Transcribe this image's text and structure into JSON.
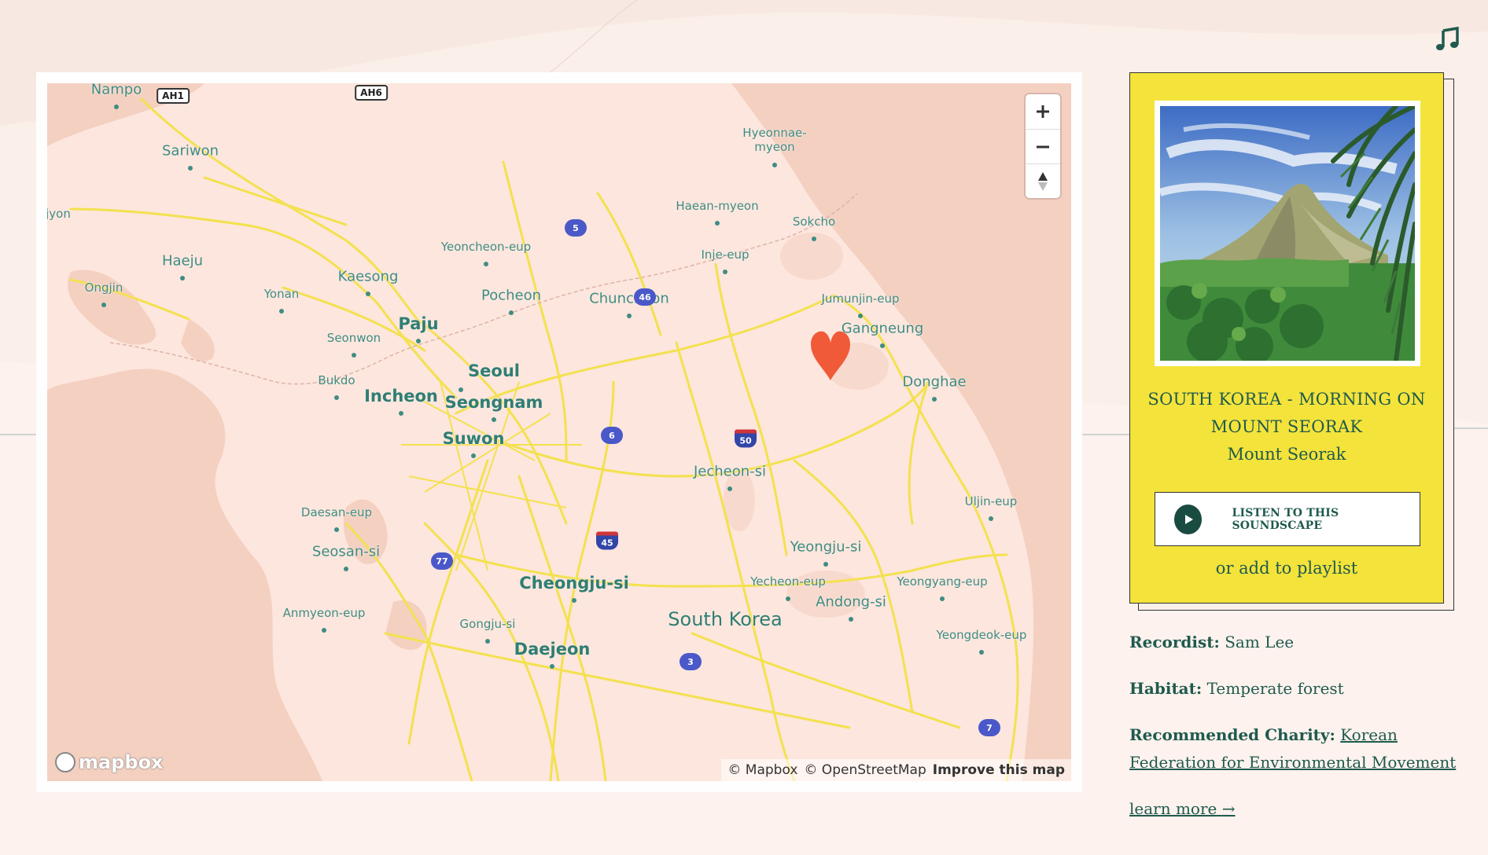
{
  "page": {
    "music_icon": "music-note-icon"
  },
  "map": {
    "zoom_in_icon": "plus-icon",
    "zoom_out_icon": "minus-icon",
    "compass_icon": "compass-icon",
    "logo_text": "mapbox",
    "attribution": {
      "mapbox": "© Mapbox",
      "osm": "© OpenStreetMap",
      "improve": "Improve this map"
    },
    "marker_icon": "heart-marker-icon",
    "marker_color": "#f05a38",
    "labels": [
      {
        "text": "Nampo",
        "cls": "mid"
      },
      {
        "text": "Sariwon",
        "cls": "mid"
      },
      {
        "text": "Haeju",
        "cls": "mid"
      },
      {
        "text": "Ongjin",
        "cls": ""
      },
      {
        "text": "Yonan",
        "cls": ""
      },
      {
        "text": "Kaesong",
        "cls": "mid"
      },
      {
        "text": "Yeoncheon-eup",
        "cls": ""
      },
      {
        "text": "Pocheon",
        "cls": "mid"
      },
      {
        "text": "Chuncheon",
        "cls": "mid"
      },
      {
        "text": "Hyeonnae-\nmyeon",
        "cls": ""
      },
      {
        "text": "Haean-myeon",
        "cls": ""
      },
      {
        "text": "Inje-eup",
        "cls": ""
      },
      {
        "text": "Sokcho",
        "cls": ""
      },
      {
        "text": "Jumunjin-eup",
        "cls": ""
      },
      {
        "text": "Gangneung",
        "cls": "mid"
      },
      {
        "text": "Donghae",
        "cls": "mid"
      },
      {
        "text": "Seonwon",
        "cls": ""
      },
      {
        "text": "Paju",
        "cls": "big"
      },
      {
        "text": "Seoul",
        "cls": "big"
      },
      {
        "text": "Bukdo",
        "cls": ""
      },
      {
        "text": "Incheon",
        "cls": "big"
      },
      {
        "text": "Seongnam",
        "cls": "big"
      },
      {
        "text": "Suwon",
        "cls": "big"
      },
      {
        "text": "Jecheon-si",
        "cls": "mid"
      },
      {
        "text": "Uljin-eup",
        "cls": ""
      },
      {
        "text": "Daesan-eup",
        "cls": ""
      },
      {
        "text": "Seosan-si",
        "cls": "mid"
      },
      {
        "text": "Yeongju-si",
        "cls": "mid"
      },
      {
        "text": "Cheongju-si",
        "cls": "big"
      },
      {
        "text": "Yecheon-eup",
        "cls": ""
      },
      {
        "text": "Yeongyang-eup",
        "cls": ""
      },
      {
        "text": "Andong-si",
        "cls": "mid"
      },
      {
        "text": "South Korea",
        "cls": "country"
      },
      {
        "text": "Anmyeon-eup",
        "cls": ""
      },
      {
        "text": "Gongju-si",
        "cls": ""
      },
      {
        "text": "Daejeon",
        "cls": "big"
      },
      {
        "text": "Yeongdeok-eup",
        "cls": ""
      },
      {
        "text": "jyon",
        "cls": ""
      }
    ],
    "shields": [
      {
        "text": "5",
        "type": "national"
      },
      {
        "text": "46",
        "type": "national"
      },
      {
        "text": "6",
        "type": "national"
      },
      {
        "text": "50",
        "type": "interstate"
      },
      {
        "text": "45",
        "type": "interstate"
      },
      {
        "text": "77",
        "type": "national"
      },
      {
        "text": "3",
        "type": "national"
      },
      {
        "text": "7",
        "type": "national"
      },
      {
        "text": "AH1",
        "type": "ah"
      },
      {
        "text": "AH6",
        "type": "ah"
      }
    ]
  },
  "card": {
    "title": "SOUTH KOREA - MORNING ON MOUNT SEORAK",
    "place": "Mount Seorak",
    "listen_label": "LISTEN TO THIS SOUNDSCAPE",
    "play_icon": "play-icon",
    "playlist_label": "or add to playlist"
  },
  "info": {
    "recordist_label": "Recordist:",
    "recordist_value": "Sam Lee",
    "habitat_label": "Habitat:",
    "habitat_value": "Temperate forest",
    "charity_label": "Recommended Charity:",
    "charity_value": "Korean Federation for Environmental Movement",
    "learn_more": "learn more",
    "arrow_icon": "arrow-right-icon"
  },
  "colors": {
    "background": "#fbefea",
    "card": "#f4e33b",
    "text": "#1f5a4d",
    "map_sea": "#f4d0c1",
    "map_land": "#fde6dd",
    "roads": "#f3e14f"
  }
}
